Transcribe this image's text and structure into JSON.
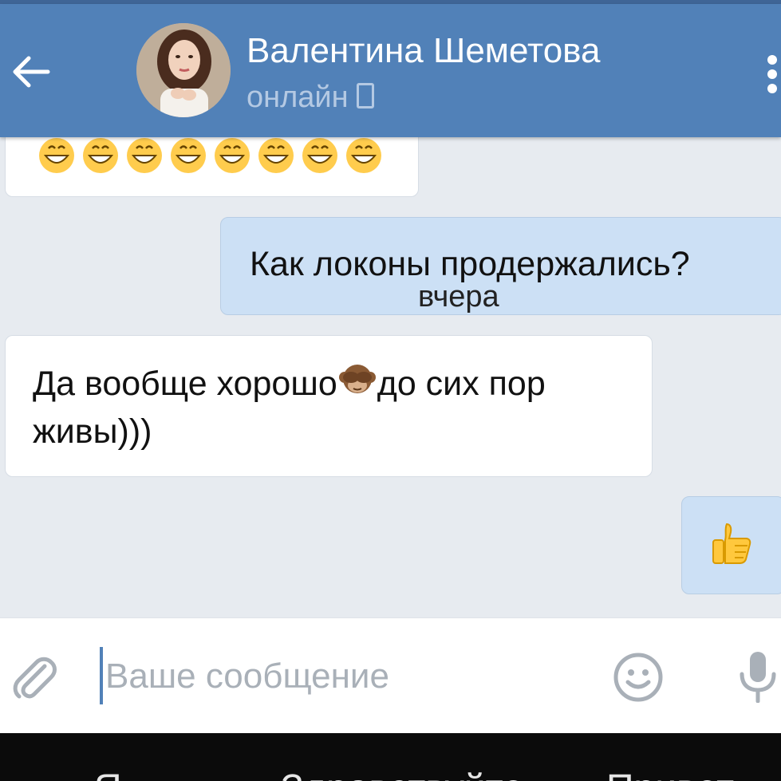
{
  "header": {
    "name": "Валентина Шеметова",
    "status": "онлайн",
    "accent": "#5181b8"
  },
  "messages": [
    {
      "dir": "in",
      "emoji": [
        "grinning-face",
        "grinning-face",
        "grinning-face",
        "grinning-face",
        "grinning-face",
        "grinning-face",
        "grinning-face",
        "grinning-face"
      ]
    },
    {
      "dir": "out",
      "text": "Как локоны продержались?",
      "time": "вчера"
    },
    {
      "dir": "in",
      "text_before": "Да вообще хорошо",
      "emoji": "see-no-evil-monkey",
      "text_after": "до сих пор живы)))"
    },
    {
      "dir": "out",
      "emoji": "thumbs-up"
    }
  ],
  "composer": {
    "placeholder": "Ваше сообщение"
  },
  "keyboard": {
    "suggestions": [
      "Я",
      "Здравствуйте",
      "Привет"
    ]
  }
}
